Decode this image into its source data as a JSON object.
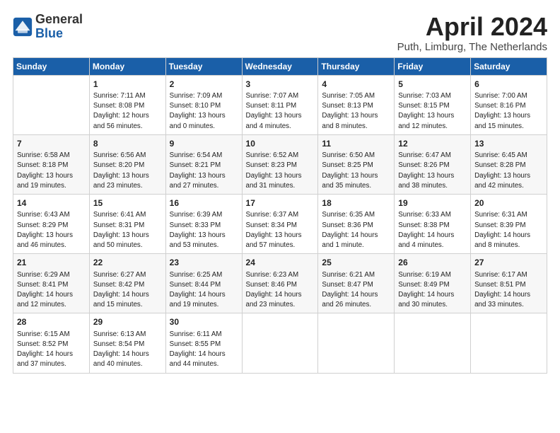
{
  "header": {
    "logo_general": "General",
    "logo_blue": "Blue",
    "month_title": "April 2024",
    "location": "Puth, Limburg, The Netherlands"
  },
  "weekdays": [
    "Sunday",
    "Monday",
    "Tuesday",
    "Wednesday",
    "Thursday",
    "Friday",
    "Saturday"
  ],
  "weeks": [
    [
      {
        "day": "",
        "info": ""
      },
      {
        "day": "1",
        "info": "Sunrise: 7:11 AM\nSunset: 8:08 PM\nDaylight: 12 hours\nand 56 minutes."
      },
      {
        "day": "2",
        "info": "Sunrise: 7:09 AM\nSunset: 8:10 PM\nDaylight: 13 hours\nand 0 minutes."
      },
      {
        "day": "3",
        "info": "Sunrise: 7:07 AM\nSunset: 8:11 PM\nDaylight: 13 hours\nand 4 minutes."
      },
      {
        "day": "4",
        "info": "Sunrise: 7:05 AM\nSunset: 8:13 PM\nDaylight: 13 hours\nand 8 minutes."
      },
      {
        "day": "5",
        "info": "Sunrise: 7:03 AM\nSunset: 8:15 PM\nDaylight: 13 hours\nand 12 minutes."
      },
      {
        "day": "6",
        "info": "Sunrise: 7:00 AM\nSunset: 8:16 PM\nDaylight: 13 hours\nand 15 minutes."
      }
    ],
    [
      {
        "day": "7",
        "info": "Sunrise: 6:58 AM\nSunset: 8:18 PM\nDaylight: 13 hours\nand 19 minutes."
      },
      {
        "day": "8",
        "info": "Sunrise: 6:56 AM\nSunset: 8:20 PM\nDaylight: 13 hours\nand 23 minutes."
      },
      {
        "day": "9",
        "info": "Sunrise: 6:54 AM\nSunset: 8:21 PM\nDaylight: 13 hours\nand 27 minutes."
      },
      {
        "day": "10",
        "info": "Sunrise: 6:52 AM\nSunset: 8:23 PM\nDaylight: 13 hours\nand 31 minutes."
      },
      {
        "day": "11",
        "info": "Sunrise: 6:50 AM\nSunset: 8:25 PM\nDaylight: 13 hours\nand 35 minutes."
      },
      {
        "day": "12",
        "info": "Sunrise: 6:47 AM\nSunset: 8:26 PM\nDaylight: 13 hours\nand 38 minutes."
      },
      {
        "day": "13",
        "info": "Sunrise: 6:45 AM\nSunset: 8:28 PM\nDaylight: 13 hours\nand 42 minutes."
      }
    ],
    [
      {
        "day": "14",
        "info": "Sunrise: 6:43 AM\nSunset: 8:29 PM\nDaylight: 13 hours\nand 46 minutes."
      },
      {
        "day": "15",
        "info": "Sunrise: 6:41 AM\nSunset: 8:31 PM\nDaylight: 13 hours\nand 50 minutes."
      },
      {
        "day": "16",
        "info": "Sunrise: 6:39 AM\nSunset: 8:33 PM\nDaylight: 13 hours\nand 53 minutes."
      },
      {
        "day": "17",
        "info": "Sunrise: 6:37 AM\nSunset: 8:34 PM\nDaylight: 13 hours\nand 57 minutes."
      },
      {
        "day": "18",
        "info": "Sunrise: 6:35 AM\nSunset: 8:36 PM\nDaylight: 14 hours\nand 1 minute."
      },
      {
        "day": "19",
        "info": "Sunrise: 6:33 AM\nSunset: 8:38 PM\nDaylight: 14 hours\nand 4 minutes."
      },
      {
        "day": "20",
        "info": "Sunrise: 6:31 AM\nSunset: 8:39 PM\nDaylight: 14 hours\nand 8 minutes."
      }
    ],
    [
      {
        "day": "21",
        "info": "Sunrise: 6:29 AM\nSunset: 8:41 PM\nDaylight: 14 hours\nand 12 minutes."
      },
      {
        "day": "22",
        "info": "Sunrise: 6:27 AM\nSunset: 8:42 PM\nDaylight: 14 hours\nand 15 minutes."
      },
      {
        "day": "23",
        "info": "Sunrise: 6:25 AM\nSunset: 8:44 PM\nDaylight: 14 hours\nand 19 minutes."
      },
      {
        "day": "24",
        "info": "Sunrise: 6:23 AM\nSunset: 8:46 PM\nDaylight: 14 hours\nand 23 minutes."
      },
      {
        "day": "25",
        "info": "Sunrise: 6:21 AM\nSunset: 8:47 PM\nDaylight: 14 hours\nand 26 minutes."
      },
      {
        "day": "26",
        "info": "Sunrise: 6:19 AM\nSunset: 8:49 PM\nDaylight: 14 hours\nand 30 minutes."
      },
      {
        "day": "27",
        "info": "Sunrise: 6:17 AM\nSunset: 8:51 PM\nDaylight: 14 hours\nand 33 minutes."
      }
    ],
    [
      {
        "day": "28",
        "info": "Sunrise: 6:15 AM\nSunset: 8:52 PM\nDaylight: 14 hours\nand 37 minutes."
      },
      {
        "day": "29",
        "info": "Sunrise: 6:13 AM\nSunset: 8:54 PM\nDaylight: 14 hours\nand 40 minutes."
      },
      {
        "day": "30",
        "info": "Sunrise: 6:11 AM\nSunset: 8:55 PM\nDaylight: 14 hours\nand 44 minutes."
      },
      {
        "day": "",
        "info": ""
      },
      {
        "day": "",
        "info": ""
      },
      {
        "day": "",
        "info": ""
      },
      {
        "day": "",
        "info": ""
      }
    ]
  ]
}
